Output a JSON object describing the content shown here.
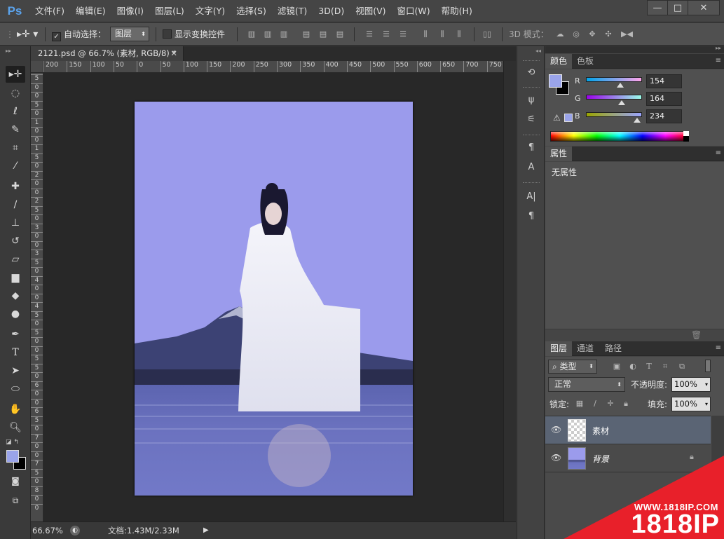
{
  "app": {
    "logo": "Ps"
  },
  "menu": [
    "文件(F)",
    "编辑(E)",
    "图像(I)",
    "图层(L)",
    "文字(Y)",
    "选择(S)",
    "滤镜(T)",
    "3D(D)",
    "视图(V)",
    "窗口(W)",
    "帮助(H)"
  ],
  "window_controls": {
    "minimize": "—",
    "maximize": "□",
    "close": "✕"
  },
  "options": {
    "auto_select_label": "自动选择：",
    "auto_select_target": "图层",
    "show_transform_label": "显示变换控件",
    "mode_3d_label": "3D 模式："
  },
  "document": {
    "tab_title": "2121.psd @ 66.7% (素材, RGB/8) *",
    "close_symbol": "✕",
    "zoom": "66.67%",
    "doc_size": "文档:1.43M/2.33M"
  },
  "rulers": {
    "top": [
      "200",
      "150",
      "100",
      "50",
      "0",
      "50",
      "100",
      "150",
      "200",
      "250",
      "300",
      "350",
      "400",
      "450",
      "500",
      "550",
      "600",
      "650",
      "700",
      "750"
    ],
    "left": [
      "5",
      "0",
      "0",
      "5",
      "0",
      "1",
      "0",
      "0",
      "1",
      "5",
      "0",
      "2",
      "0",
      "0",
      "2",
      "5",
      "0",
      "3",
      "0",
      "0",
      "3",
      "5",
      "0",
      "4",
      "0",
      "0",
      "4",
      "5",
      "0",
      "5",
      "0",
      "0",
      "5",
      "5",
      "0",
      "6",
      "0",
      "0",
      "6",
      "5",
      "0",
      "7",
      "0",
      "0",
      "7",
      "5",
      "0",
      "8",
      "0",
      "0"
    ]
  },
  "color_panel": {
    "tabs": [
      "颜色",
      "色板"
    ],
    "channels": [
      {
        "label": "R",
        "value": "154"
      },
      {
        "label": "G",
        "value": "164"
      },
      {
        "label": "B",
        "value": "234"
      }
    ],
    "foreground": "#9aa4ea",
    "background": "#000000"
  },
  "properties_panel": {
    "tab": "属性",
    "content": "无属性"
  },
  "layers_panel": {
    "tabs": [
      "图层",
      "通道",
      "路径"
    ],
    "filter_kind": "类型",
    "blend_mode": "正常",
    "opacity_label": "不透明度:",
    "opacity_value": "100%",
    "lock_label": "锁定:",
    "fill_label": "填充:",
    "fill_value": "100%",
    "layers": [
      {
        "name": "素材",
        "selected": true
      },
      {
        "name": "背景",
        "selected": false,
        "locked": true
      }
    ]
  },
  "watermark": {
    "url": "WWW.1818IP.COM",
    "brand": "1818IP"
  }
}
